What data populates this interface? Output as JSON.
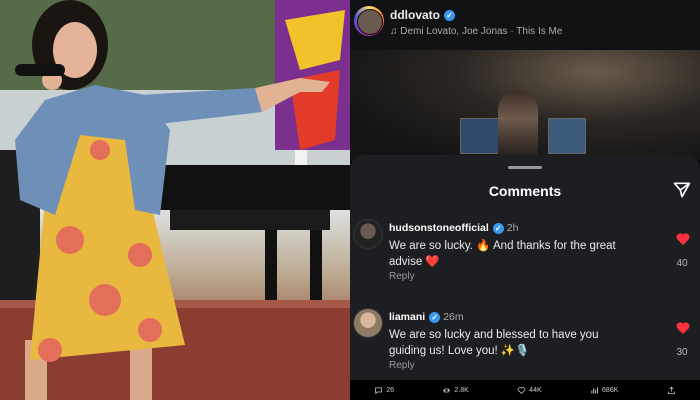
{
  "header": {
    "username": "ddlovato",
    "music": "Demi Lovato, Joe Jonas · This Is Me"
  },
  "comments_sheet": {
    "title": "Comments",
    "comments": [
      {
        "username": "hudsonstoneofficial",
        "time": "2h",
        "text": "We are so lucky. 🔥 And thanks for the great advise ❤️",
        "reply_label": "Reply",
        "likes": "40"
      },
      {
        "username": "liamani",
        "time": "26m",
        "text": "We are so lucky and blessed to have you guiding us! Love you! ✨🎙️",
        "reply_label": "Reply",
        "likes": "30"
      }
    ]
  },
  "bottom_bar": {
    "replies": "26",
    "reposts": "2.8K",
    "likes": "44K",
    "views": "686K"
  },
  "colors": {
    "heart": "#ff3040",
    "verified": "#3897f0",
    "sheet_bg": "#1c1e21"
  }
}
